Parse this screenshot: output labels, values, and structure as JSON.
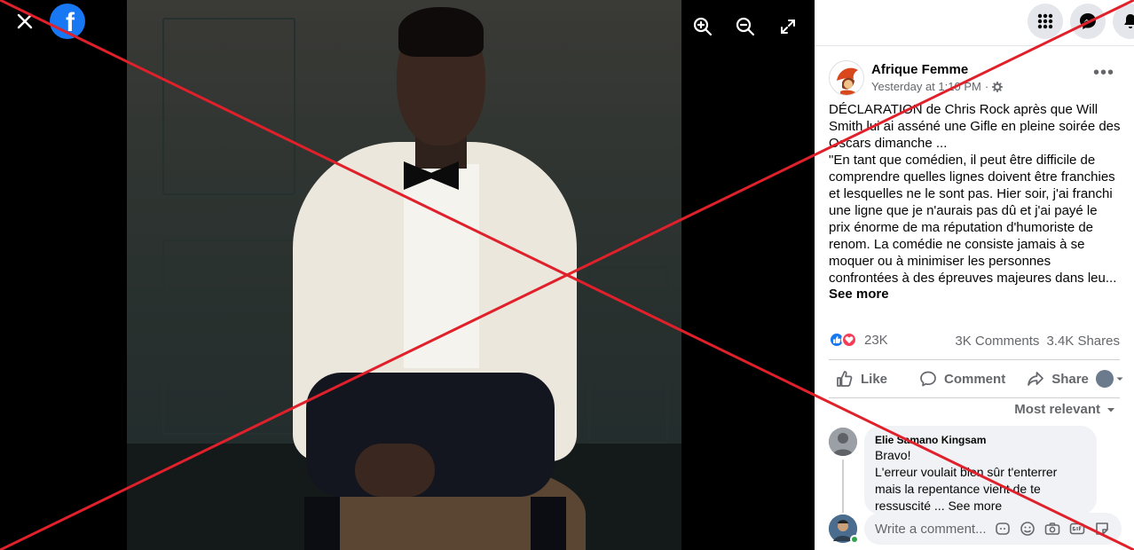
{
  "viewer": {
    "close_label": "×",
    "logo_letter": "f",
    "controls": [
      "zoom-in",
      "zoom-out",
      "fullscreen"
    ]
  },
  "topbar": {
    "icons": [
      "menu-grid-icon",
      "messenger-icon",
      "notifications-icon"
    ]
  },
  "post": {
    "page_name": "Afrique Femme",
    "timestamp": "Yesterday at 1:10 PM",
    "audience_separator": "·",
    "more_label": "•••",
    "text_lines": [
      "DÉCLARATION de Chris Rock après que Will Smith lui ai asséné une Gifle en pleine soirée des Oscars dimanche ...",
      "\"En tant que comédien, il peut être difficile de comprendre quelles lignes doivent être franchies et lesquelles ne le sont pas. Hier soir, j'ai franchi une ligne que je n'aurais pas dû et j'ai payé le prix énorme de ma réputation d'humoriste de renom. La comédie ne consiste jamais à se moquer ou à minimiser les personnes confrontées à des épreuves majeures dans leu..."
    ],
    "see_more": "See more",
    "reaction_count": "23K",
    "comments_count": "3K Comments",
    "shares_count": "3.4K Shares",
    "actions": {
      "like": "Like",
      "comment": "Comment",
      "share": "Share"
    },
    "sort_label": "Most relevant"
  },
  "comment": {
    "author": "Elie Samano Kingsam",
    "lines": [
      "Bravo!",
      "L'erreur voulait bien sûr t'enterrer mais la repentance vient de te ressuscité ... See more"
    ]
  },
  "composer": {
    "placeholder": "Write a comment..."
  },
  "colors": {
    "brand": "#1877f2",
    "like": "#1877f2",
    "love": "#f33e58",
    "overlay_cross": "#e0202a"
  }
}
